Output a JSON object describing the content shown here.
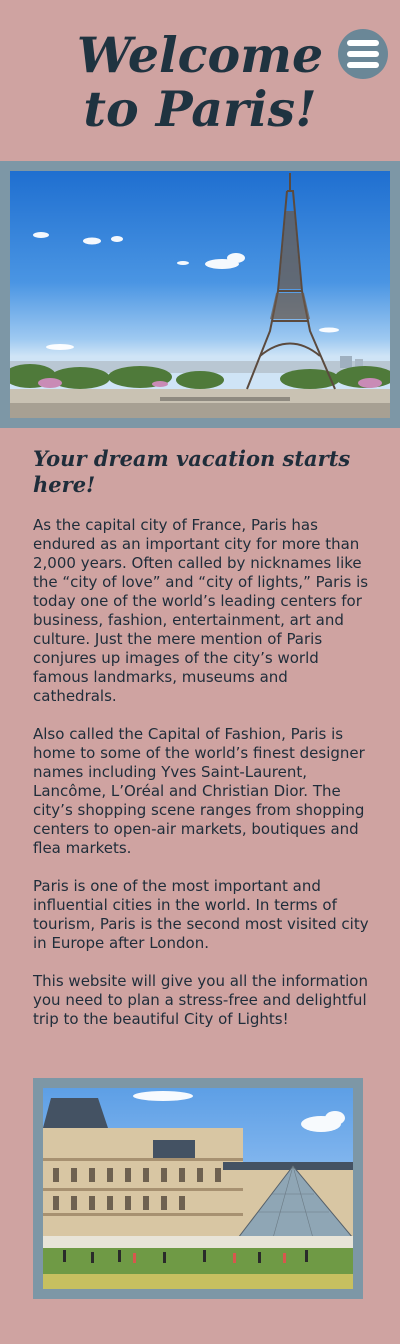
{
  "header": {
    "title": "Welcome to Paris!",
    "menu_icon": "hamburger-menu-icon"
  },
  "hero": {
    "image": "eiffel-tower-photo"
  },
  "content": {
    "subheading": "Your dream vacation starts here!",
    "paragraphs": [
      "As the capital city of France, Paris has endured as an important city for more than 2,000 years. Often called by nicknames like the “city of love” and “city of lights,” Paris is today one of the world’s leading centers for business, fashion, entertainment, art and culture. Just the mere mention of Paris conjures up images of the city’s world famous landmarks, museums and cathedrals.",
      "Also called the Capital of Fashion, Paris is home to some of the world’s finest designer names including Yves Saint-Laurent, Lancôme, L’Oréal and Christian Dior. The city’s shopping scene ranges from shopping centers to open-air markets, boutiques and flea markets.",
      "Paris is one of the most important and influential cities in the world. In terms of tourism, Paris is the second most visited city in Europe after London.",
      "This website will give you all the information you need to plan a stress-free and delightful trip to the beautiful City of Lights!"
    ]
  },
  "gallery": {
    "image": "louvre-museum-photo"
  },
  "colors": {
    "background": "#cfa3a1",
    "frame": "#7d97a6",
    "menu_button": "#6a8797",
    "text": "#1f2d3a"
  }
}
